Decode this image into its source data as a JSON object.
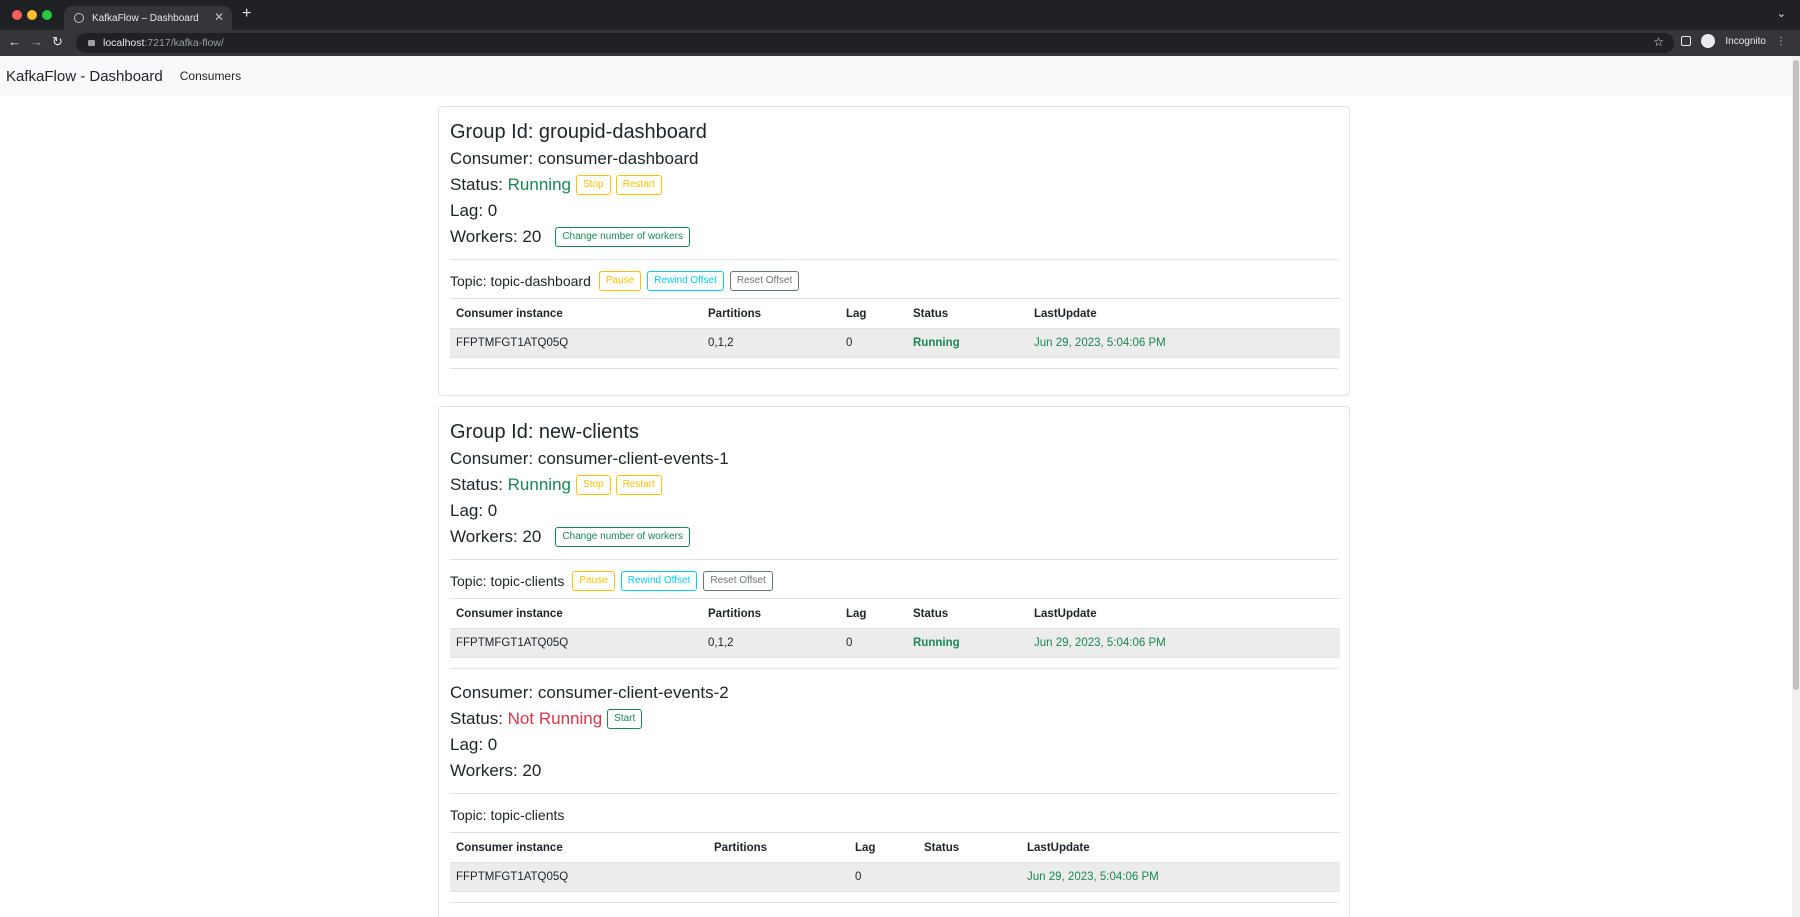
{
  "browser": {
    "tab_title": "KafkaFlow – Dashboard",
    "tab_close": "✕",
    "new_tab": "+",
    "url_host": "localhost",
    "url_path": ":7217/kafka-flow/",
    "profile_label": "Incognito"
  },
  "navbar": {
    "brand": "KafkaFlow - Dashboard",
    "consumers_link": "Consumers"
  },
  "groups": [
    {
      "group_id": "Group Id: groupid-dashboard",
      "consumers": [
        {
          "name": "Consumer: consumer-dashboard",
          "status_label": "Status:",
          "status": "Running",
          "buttons": {
            "stop": "Stop",
            "restart": "Restart"
          },
          "lag": "Lag: 0",
          "workers": "Workers: 20",
          "change_workers": "Change number of workers",
          "topic": "Topic: topic-dashboard",
          "topic_buttons": {
            "pause": "Pause",
            "rewind": "Rewind Offset",
            "reset": "Reset Offset"
          },
          "table": {
            "headers": [
              "Consumer instance",
              "Partitions",
              "Lag",
              "Status",
              "LastUpdate"
            ],
            "rows": [
              [
                "FFPTMFGT1ATQ05Q",
                "0,1,2",
                "0",
                "Running",
                "Jun 29, 2023, 5:04:06 PM"
              ]
            ]
          }
        }
      ]
    },
    {
      "group_id": "Group Id: new-clients",
      "consumers": [
        {
          "name": "Consumer: consumer-client-events-1",
          "status_label": "Status:",
          "status": "Running",
          "buttons": {
            "stop": "Stop",
            "restart": "Restart"
          },
          "lag": "Lag: 0",
          "workers": "Workers: 20",
          "change_workers": "Change number of workers",
          "topic": "Topic: topic-clients",
          "topic_buttons": {
            "pause": "Pause",
            "rewind": "Rewind Offset",
            "reset": "Reset Offset"
          },
          "table": {
            "headers": [
              "Consumer instance",
              "Partitions",
              "Lag",
              "Status",
              "LastUpdate"
            ],
            "rows": [
              [
                "FFPTMFGT1ATQ05Q",
                "0,1,2",
                "0",
                "Running",
                "Jun 29, 2023, 5:04:06 PM"
              ]
            ]
          }
        },
        {
          "name": "Consumer: consumer-client-events-2",
          "status_label": "Status:",
          "status": "Not Running",
          "buttons": {
            "start": "Start"
          },
          "lag": "Lag: 0",
          "workers": "Workers: 20",
          "topic": "Topic: topic-clients",
          "table": {
            "headers": [
              "Consumer instance",
              "Partitions",
              "Lag",
              "Status",
              "LastUpdate"
            ],
            "rows": [
              [
                "FFPTMFGT1ATQ05Q",
                "",
                "0",
                "",
                "Jun 29, 2023, 5:04:06 PM"
              ]
            ]
          }
        }
      ]
    }
  ],
  "colors": {
    "running": "#198754",
    "not_running": "#dc3545",
    "warning": "#ffc107",
    "info": "#0dcaf0",
    "secondary": "#6c757d"
  }
}
